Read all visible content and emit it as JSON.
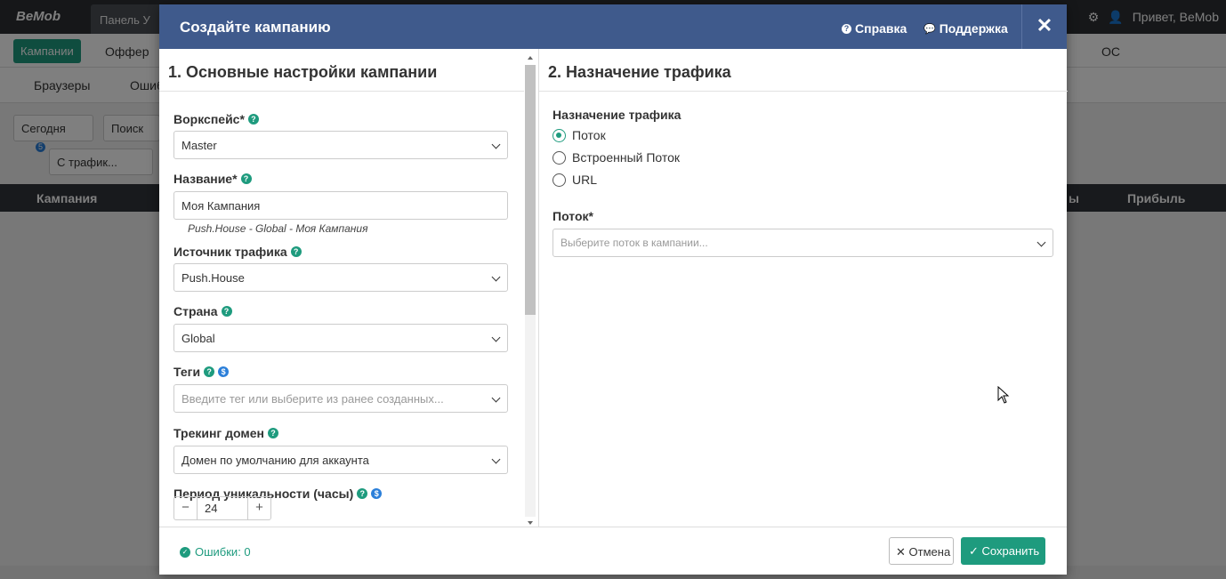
{
  "background": {
    "logo": "BeMob",
    "tab": "Панель У",
    "greeting": "Привет, BeMob",
    "nav": {
      "campaigns": "Кампании",
      "offers": "Оффер",
      "browsers": "Браузеры",
      "errors": "Ошиб",
      "os": "ОС"
    },
    "filters": {
      "today": "Сегодня",
      "search": "Поиск",
      "traffic": "С трафик..."
    },
    "badge_count": "5",
    "table": {
      "campaign_col": "Кампания",
      "col_partial": "ы",
      "profit_col": "Прибыль"
    }
  },
  "modal": {
    "title": "Создайте кампанию",
    "help_link": "Справка",
    "support_link": "Поддержка",
    "close": "✕"
  },
  "left": {
    "section_title": "1. Основные настройки кампании",
    "workspace_label": "Воркспейс*",
    "workspace_value": "Master",
    "name_label": "Название*",
    "name_value": "Моя Кампания",
    "name_hint": "Push.House - Global - Моя Кампания",
    "source_label": "Источник трафика",
    "source_value": "Push.House",
    "country_label": "Страна",
    "country_value": "Global",
    "tags_label": "Теги",
    "tags_placeholder": "Введите тег или выберите из ранее созданных...",
    "domain_label": "Трекинг домен",
    "domain_value": "Домен по умолчанию для аккаунта",
    "uniq_label": "Период уникальности (часы)",
    "uniq_value": "24",
    "minus": "−",
    "plus": "+"
  },
  "right": {
    "section_title": "2. Назначение трафика",
    "dest_label": "Назначение трафика",
    "options": [
      "Поток",
      "Встроенный Поток",
      "URL"
    ],
    "selected": "Поток",
    "flow_label": "Поток*",
    "flow_placeholder": "Выберите поток в кампании..."
  },
  "footer": {
    "errors": "Ошибки: 0",
    "cancel": "Отмена",
    "save": "Сохранить"
  },
  "colors": {
    "header": "#3f5a8c",
    "accent": "#1e9b7e",
    "info": "#2b7fd9"
  }
}
